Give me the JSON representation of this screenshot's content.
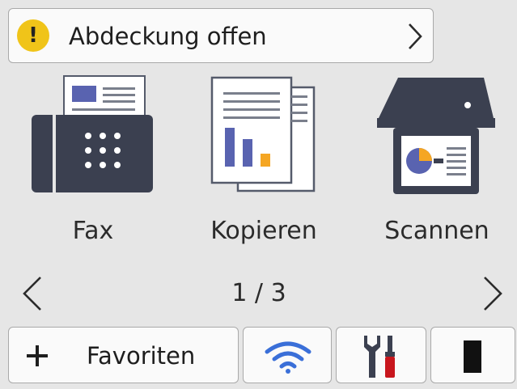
{
  "status": {
    "icon": "warning-icon",
    "icon_glyph": "!",
    "message": "Abdeckung offen",
    "color": "#f0c419"
  },
  "tiles": [
    {
      "label": "Fax",
      "icon": "fax-icon"
    },
    {
      "label": "Kopieren",
      "icon": "copy-icon"
    },
    {
      "label": "Scannen",
      "icon": "scan-icon"
    }
  ],
  "pager": {
    "indicator": "1 / 3",
    "current_page": 1,
    "total_pages": 3
  },
  "bottom": {
    "favorites_label": "Favoriten",
    "wifi_icon": "wifi-icon",
    "tools_icon": "tools-icon",
    "toner_icon": "toner-icon"
  },
  "colors": {
    "background": "#e6e6e6",
    "accent_blue": "#5963b0",
    "accent_orange": "#f5a623",
    "dark_slate": "#3b4050",
    "tool_red": "#c8161d"
  }
}
